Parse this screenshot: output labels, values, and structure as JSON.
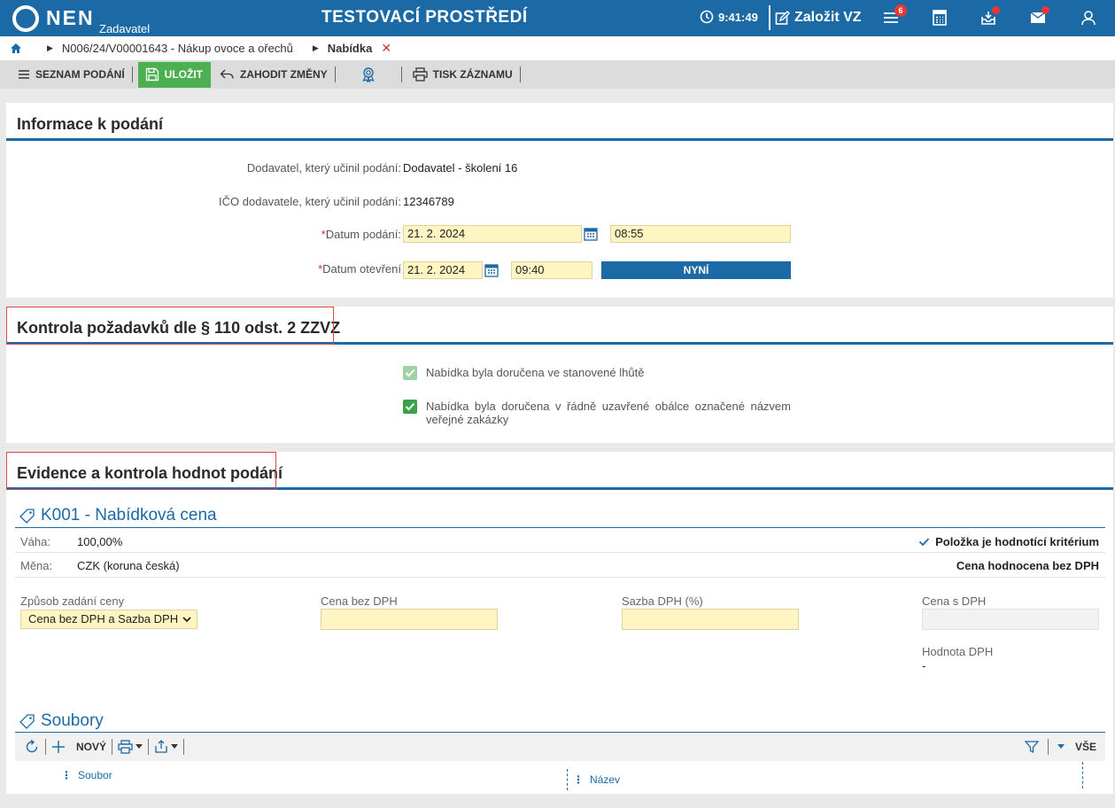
{
  "topbar": {
    "logo": "NEN",
    "logo_sub": "Zadavatel",
    "env_title": "TESTOVACÍ PROSTŘEDÍ",
    "clock": "9:41:49",
    "create_vz": "Založit VZ",
    "menu_badge": "6"
  },
  "breadcrumb": {
    "link": "N006/24/V00001643 - Nákup ovoce a ořechů",
    "current": "Nabídka",
    "close": "✕"
  },
  "toolbar": {
    "list_label": "SEZNAM PODÁNÍ",
    "save_label": "ULOŽIT",
    "discard_label": "ZAHODIT ZMĚNY",
    "print_label": "TISK ZÁZNAMU"
  },
  "info": {
    "title": "Informace k podání",
    "supplier_label": "Dodavatel, který učinil podání:",
    "supplier_value": "Dodavatel - školení 16",
    "ico_label": "IČO dodavatele, který učinil podání:",
    "ico_value": "12346789",
    "date_sub_label": "Datum podání:",
    "date_sub_value": "21. 2. 2024",
    "time_sub_value": "08:55",
    "date_open_label": "Datum otevření",
    "date_open_value": "21. 2. 2024",
    "time_open_value": "09:40",
    "now_label": "NYNÍ",
    "required_mark": "*"
  },
  "control": {
    "title": "Kontrola požadavků dle § 110 odst. 2 ZZVZ",
    "check1": "Nabídka byla doručena ve stanovené lhůtě",
    "check2": "Nabídka byla doručena v řádně uzavřené obálce označené názvem veřejné zakázky"
  },
  "evidence": {
    "title": "Evidence a kontrola hodnot podání",
    "criterion_title": "K001 - Nabídková cena",
    "weight_label": "Váha:",
    "weight_value": "100,00%",
    "currency_label": "Měna:",
    "currency_value": "CZK (koruna česká)",
    "is_criterion": "Položka je hodnotící kritérium",
    "evaluated": "Cena hodnocena bez DPH",
    "price_mode_label": "Způsob zadání ceny",
    "price_mode_value": "Cena bez DPH a Sazba DPH",
    "price_no_vat_label": "Cena bez DPH",
    "vat_rate_label": "Sazba DPH (%)",
    "price_vat_label": "Cena s DPH",
    "vat_value_label": "Hodnota DPH",
    "vat_value": "-"
  },
  "files": {
    "title": "Soubory",
    "new_label": "NOVÝ",
    "all_label": "VŠE",
    "col_file": "Soubor",
    "col_name": "Název"
  },
  "colors": {
    "brand": "#1b6aa5",
    "save": "#4caf50",
    "field": "#fff5c2",
    "marker": "#e04848"
  }
}
